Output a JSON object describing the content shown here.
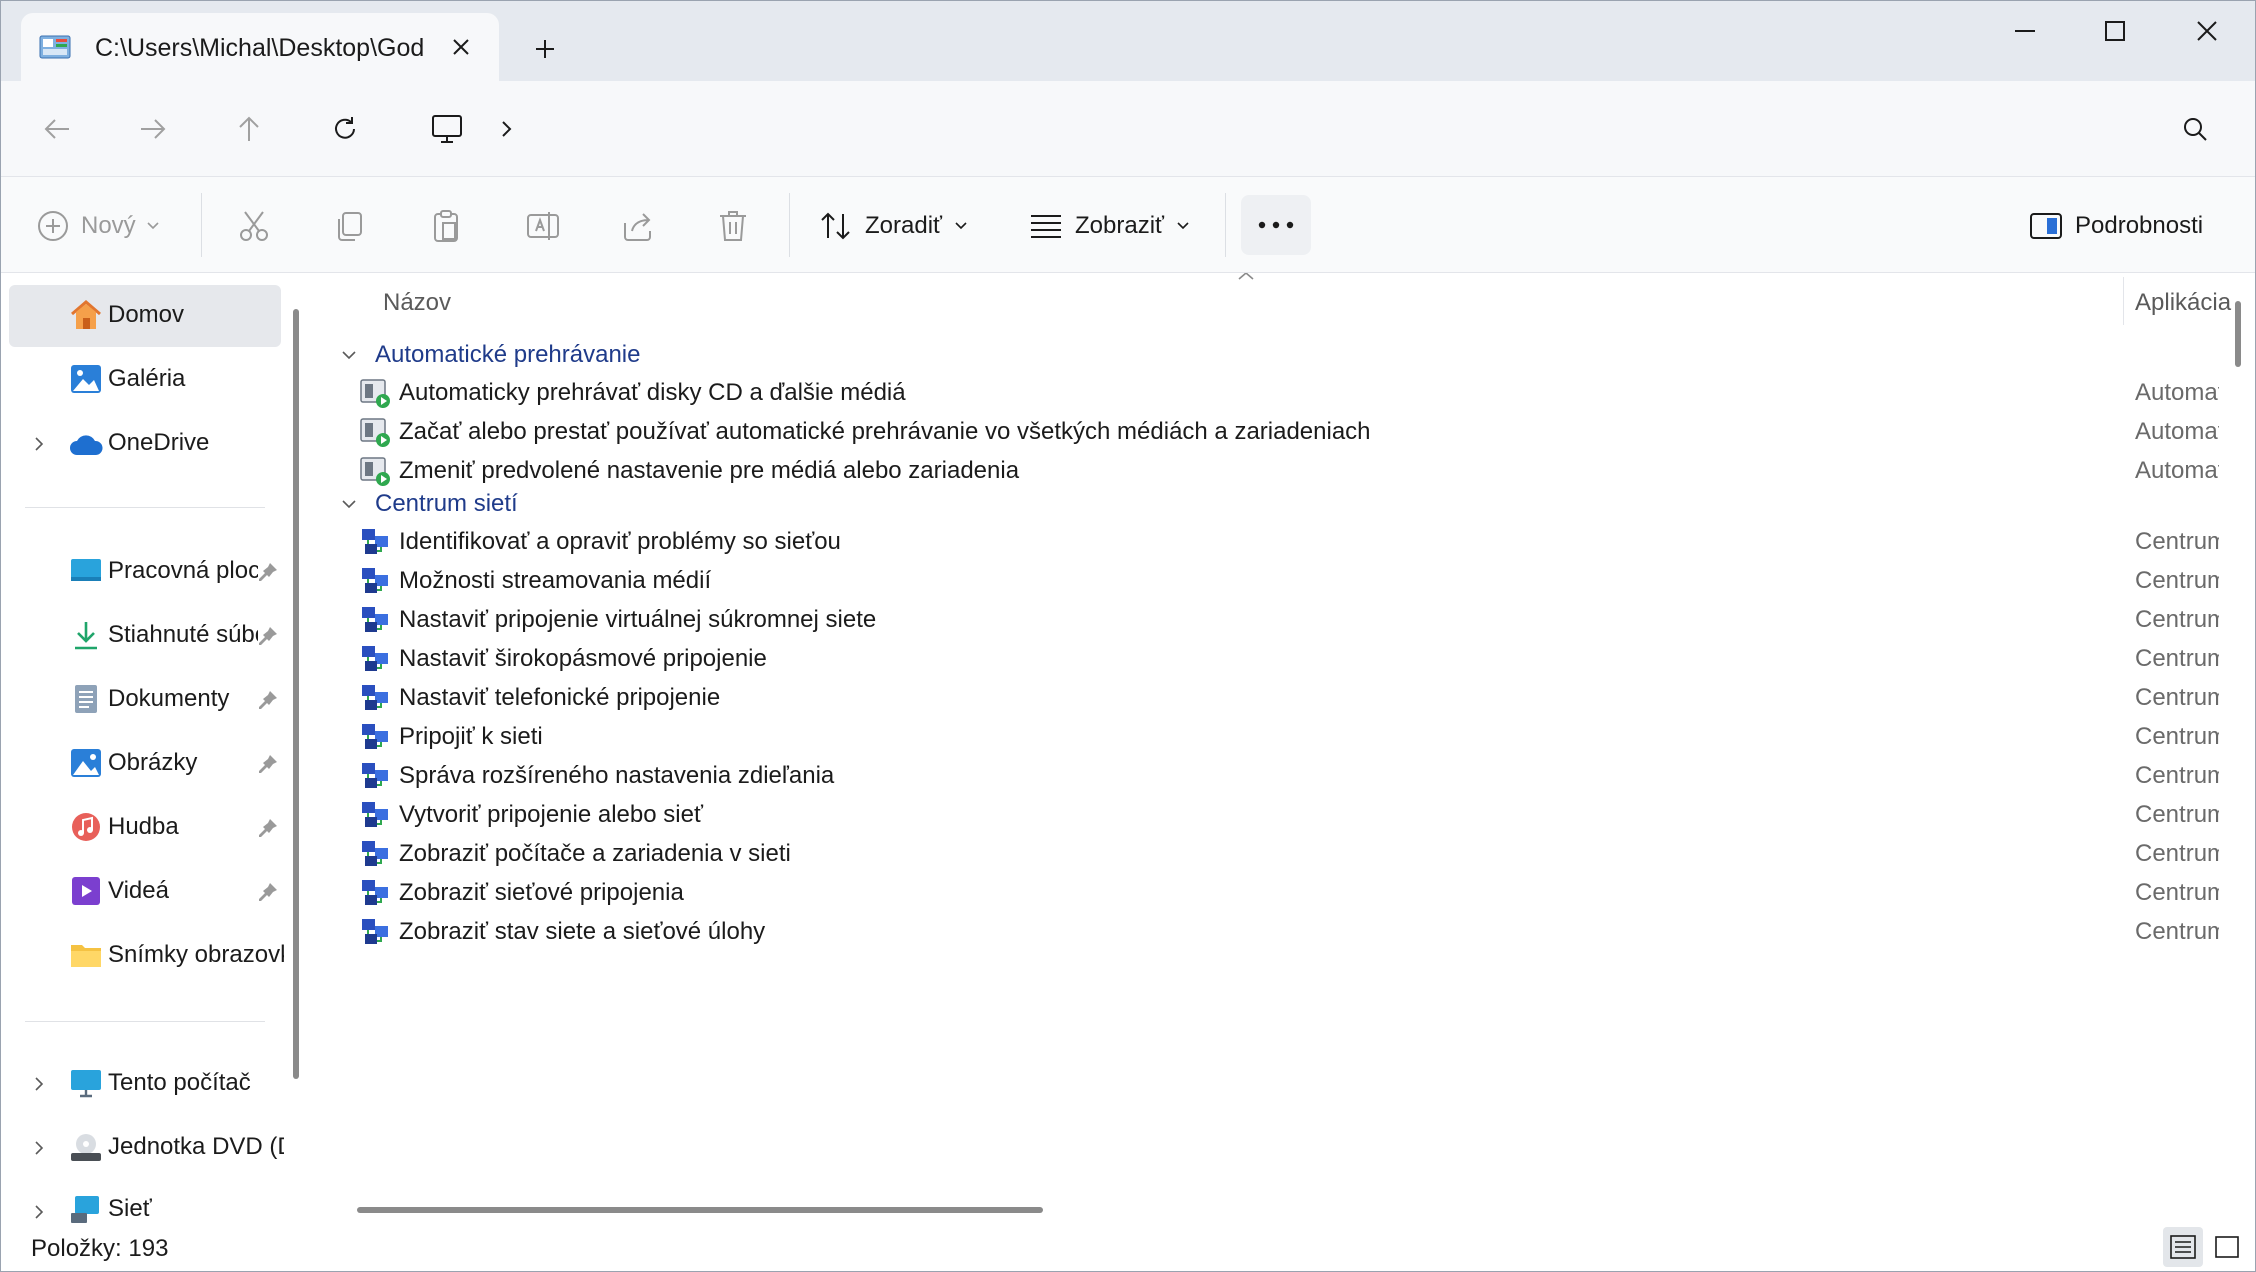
{
  "tab": {
    "title": "C:\\Users\\Michal\\Desktop\\God"
  },
  "toolbar": {
    "new_label": "Nový",
    "sort_label": "Zoradiť",
    "view_label": "Zobraziť",
    "details_label": "Podrobnosti"
  },
  "sidebar": {
    "items": [
      {
        "label": "Domov",
        "icon": "home-icon"
      },
      {
        "label": "Galéria",
        "icon": "gallery-icon"
      },
      {
        "label": "OneDrive",
        "icon": "cloud-icon"
      },
      {
        "label": "Pracovná plocha",
        "icon": "desktop-folder-icon"
      },
      {
        "label": "Stiahnuté súbory",
        "icon": "download-icon"
      },
      {
        "label": "Dokumenty",
        "icon": "documents-icon"
      },
      {
        "label": "Obrázky",
        "icon": "pictures-icon"
      },
      {
        "label": "Hudba",
        "icon": "music-icon"
      },
      {
        "label": "Videá",
        "icon": "videos-icon"
      },
      {
        "label": "Snímky obrazovky",
        "icon": "folder-icon"
      },
      {
        "label": "Tento počítač",
        "icon": "this-pc-icon"
      },
      {
        "label": "Jednotka DVD (D:)",
        "icon": "dvd-drive-icon"
      },
      {
        "label": "Sieť",
        "icon": "network-icon"
      }
    ]
  },
  "columns": {
    "name": "Názov",
    "app": "Aplikácia"
  },
  "groups": [
    {
      "label": "Automatické prehrávanie",
      "rows": [
        {
          "name": "Automaticky prehrávať disky CD a ďalšie médiá",
          "app": "Automatické prehrávanie"
        },
        {
          "name": "Začať alebo prestať používať automatické prehrávanie vo všetkých médiách a zariadeniach",
          "app": "Automatické prehrávanie"
        },
        {
          "name": "Zmeniť predvolené nastavenie pre médiá alebo zariadenia",
          "app": "Automatické prehrávanie"
        }
      ]
    },
    {
      "label": "Centrum sietí",
      "rows": [
        {
          "name": "Identifikovať a opraviť problémy so sieťou",
          "app": "Centrum sietí"
        },
        {
          "name": "Možnosti streamovania médií",
          "app": "Centrum sietí"
        },
        {
          "name": "Nastaviť pripojenie virtuálnej súkromnej siete",
          "app": "Centrum sietí"
        },
        {
          "name": "Nastaviť širokopásmové pripojenie",
          "app": "Centrum sietí"
        },
        {
          "name": "Nastaviť telefonické pripojenie",
          "app": "Centrum sietí"
        },
        {
          "name": "Pripojiť k sieti",
          "app": "Centrum sietí"
        },
        {
          "name": "Správa rozšíreného nastavenia zdieľania",
          "app": "Centrum sietí"
        },
        {
          "name": "Vytvoriť pripojenie alebo sieť",
          "app": "Centrum sietí"
        },
        {
          "name": "Zobraziť počítače a zariadenia v sieti",
          "app": "Centrum sietí"
        },
        {
          "name": "Zobraziť sieťové pripojenia",
          "app": "Centrum sietí"
        },
        {
          "name": "Zobraziť stav siete a sieťové úlohy",
          "app": "Centrum sietí"
        }
      ]
    }
  ],
  "status": {
    "items": "Položky: 193"
  },
  "colors": {
    "accent": "#1f3b8a",
    "selected": "#e6e8ec"
  }
}
